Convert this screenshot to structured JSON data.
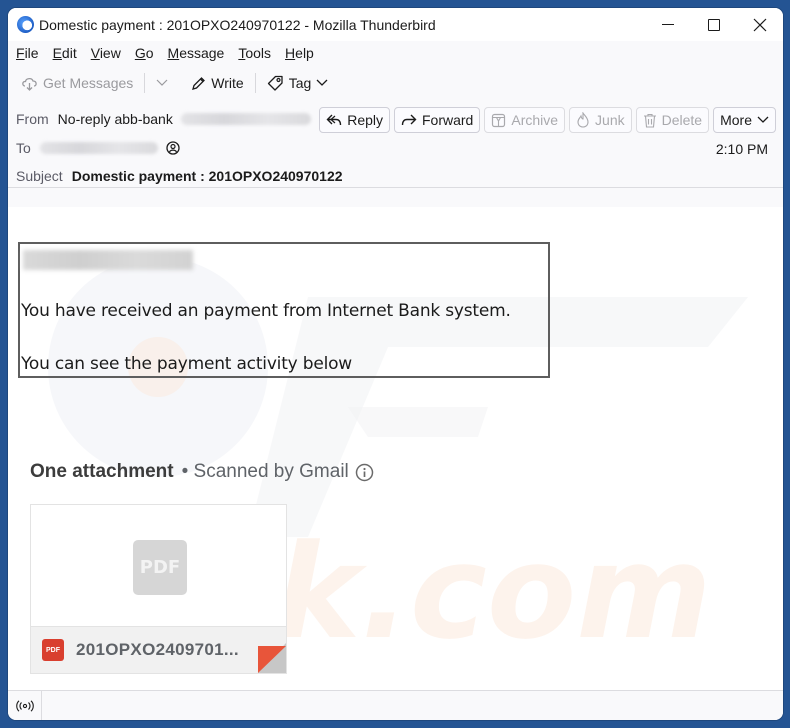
{
  "window": {
    "title": "Domestic payment : 201OPXO240970122 - Mozilla Thunderbird",
    "controls": {
      "minimize": "minimize",
      "maximize": "maximize",
      "close": "close"
    }
  },
  "menubar": {
    "items": [
      {
        "label": "File",
        "accel": "F",
        "rest": "ile"
      },
      {
        "label": "Edit",
        "accel": "E",
        "rest": "dit"
      },
      {
        "label": "View",
        "accel": "V",
        "rest": "iew"
      },
      {
        "label": "Go",
        "accel": "G",
        "rest": "o"
      },
      {
        "label": "Message",
        "accel": "M",
        "rest": "essage"
      },
      {
        "label": "Tools",
        "accel": "T",
        "rest": "ools"
      },
      {
        "label": "Help",
        "accel": "H",
        "rest": "elp"
      }
    ]
  },
  "toolbar": {
    "get_messages": "Get Messages",
    "write": "Write",
    "tag": "Tag"
  },
  "header": {
    "from_label": "From",
    "from_name": "No-reply abb-bank",
    "to_label": "To",
    "subject_label": "Subject",
    "subject": "Domestic payment : 201OPXO240970122",
    "time": "2:10 PM",
    "actions": {
      "reply": "Reply",
      "forward": "Forward",
      "archive": "Archive",
      "junk": "Junk",
      "delete": "Delete",
      "more": "More"
    }
  },
  "body": {
    "line1": "You have received an payment from Internet Bank system.",
    "line2": "You can see the payment activity below",
    "attachment_heading": "One attachment",
    "scanned_label": "• Scanned by Gmail",
    "attachment": {
      "thumb_label": "PDF",
      "type_badge": "PDF",
      "name": "201OPXO2409701..."
    }
  },
  "colors": {
    "desktop": "#245493",
    "pdf_red": "#d93f2f",
    "box_border": "#5e5e5e"
  }
}
